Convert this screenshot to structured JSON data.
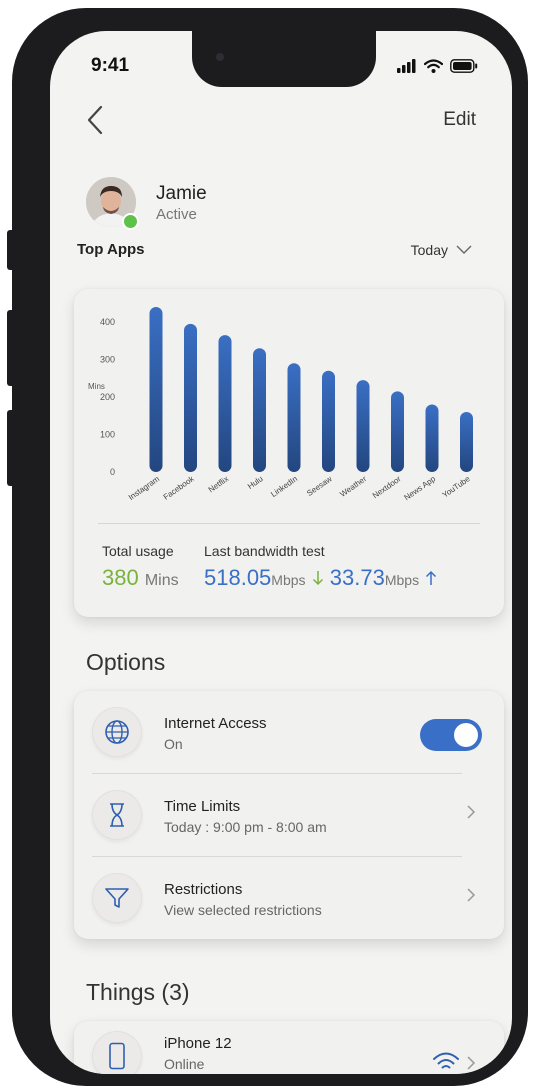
{
  "status_bar": {
    "time": "9:41"
  },
  "header": {
    "edit_label": "Edit"
  },
  "profile": {
    "name": "Jamie",
    "status": "Active"
  },
  "top_apps": {
    "title": "Top Apps",
    "period": "Today"
  },
  "chart_data": {
    "type": "bar",
    "ylabel": "Mins",
    "ylim": [
      0,
      450
    ],
    "yticks": [
      0,
      100,
      200,
      300,
      400
    ],
    "categories": [
      "Instagram",
      "Facebook",
      "Netflix",
      "Hulu",
      "LinkedIn",
      "Seesaw",
      "Weather",
      "Nextdoor",
      "News App",
      "YouTube"
    ],
    "values": [
      440,
      395,
      365,
      330,
      290,
      270,
      245,
      215,
      180,
      160
    ]
  },
  "usage": {
    "total_label": "Total usage",
    "total_value": "380",
    "total_unit": "Mins",
    "bandwidth_label": "Last bandwidth test",
    "download_value": "518.05",
    "download_unit": "Mbps",
    "upload_value": "33.73",
    "upload_unit": "Mbps"
  },
  "options": {
    "title": "Options",
    "items": [
      {
        "title": "Internet Access",
        "subtitle": "On",
        "icon": "globe-icon"
      },
      {
        "title": "Time Limits",
        "subtitle": "Today : 9:00 pm - 8:00 am",
        "icon": "hourglass-icon"
      },
      {
        "title": "Restrictions",
        "subtitle": "View selected restrictions",
        "icon": "filter-icon"
      }
    ],
    "internet_access_on": true
  },
  "things": {
    "title": "Things (3)",
    "items": [
      {
        "name": "iPhone 12",
        "status": "Online",
        "icon": "phone-icon"
      }
    ]
  },
  "colors": {
    "accent": "#3a6fc7",
    "green": "#7ab33e",
    "bar": "#2f62ad"
  }
}
